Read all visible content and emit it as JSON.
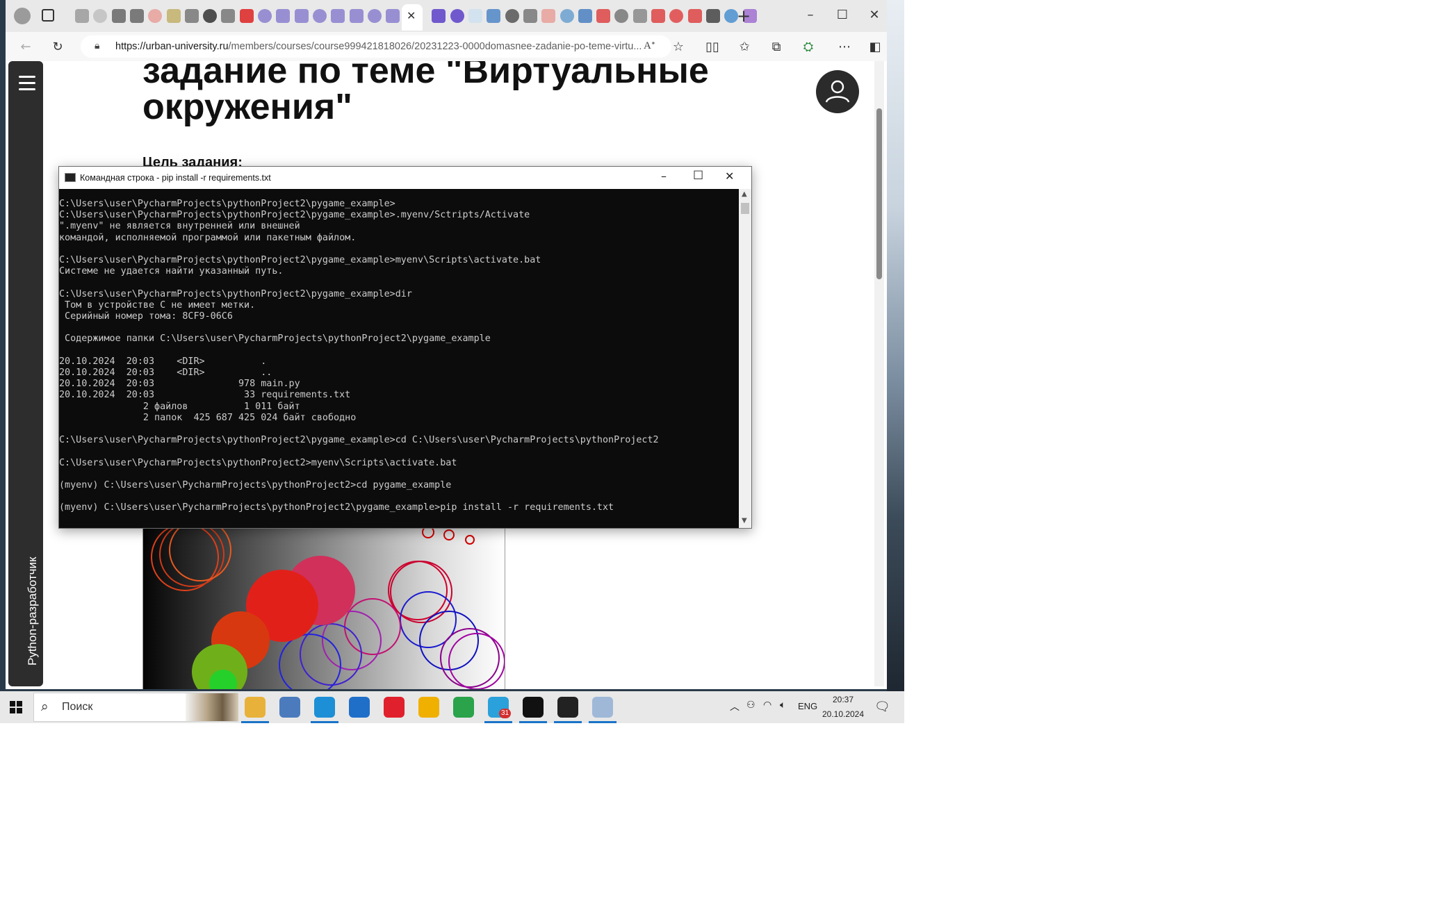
{
  "browser": {
    "url_domain": "https://urban-university.ru",
    "url_path": "/members/courses/course999421818026/20231223-0000domasnee-zadanie-po-teme-virtu...",
    "tab_colors": [
      "#9b9b9b",
      "#c0c0c0",
      "#666",
      "#666",
      "#e8a09a",
      "#c2b06a",
      "#777",
      "#333",
      "#777",
      "#d22",
      "#8a7fcf",
      "#8a7fcf",
      "#8a7fcf",
      "#8a7fcf",
      "#8a7fcf",
      "#8a7fcf",
      "#8a7fcf",
      "#8a7fcf",
      "#5a40c8",
      "#5a40c8",
      "#cfe0f0",
      "#4f86c6",
      "#555",
      "#777",
      "#e8a09a",
      "#6aa0d0",
      "#4a80c0",
      "#d44",
      "#777",
      "#888",
      "#d44",
      "#e04545",
      "#d44",
      "#444",
      "#4a8fd0",
      "#a070d0"
    ]
  },
  "page": {
    "heading": "задание по теме \"Виртуальные окружения\"",
    "goal_label": "Цель задания:",
    "course_label": "Python-разработчик"
  },
  "cmd": {
    "title": "Командная строка - pip  install -r requirements.txt",
    "lines": [
      "C:\\Users\\user\\PycharmProjects\\pythonProject2\\pygame_example>",
      "C:\\Users\\user\\PycharmProjects\\pythonProject2\\pygame_example>.myenv/Sctripts/Activate",
      "\".myenv\" не является внутренней или внешней",
      "командой, исполняемой программой или пакетным файлом.",
      "",
      "C:\\Users\\user\\PycharmProjects\\pythonProject2\\pygame_example>myenv\\Scripts\\activate.bat",
      "Системе не удается найти указанный путь.",
      "",
      "C:\\Users\\user\\PycharmProjects\\pythonProject2\\pygame_example>dir",
      " Том в устройстве C не имеет метки.",
      " Серийный номер тома: 8CF9-06C6",
      "",
      " Содержимое папки C:\\Users\\user\\PycharmProjects\\pythonProject2\\pygame_example",
      "",
      "20.10.2024  20:03    <DIR>          .",
      "20.10.2024  20:03    <DIR>          ..",
      "20.10.2024  20:03               978 main.py",
      "20.10.2024  20:03                33 requirements.txt",
      "               2 файлов          1 011 байт",
      "               2 папок  425 687 425 024 байт свободно",
      "",
      "C:\\Users\\user\\PycharmProjects\\pythonProject2\\pygame_example>cd C:\\Users\\user\\PycharmProjects\\pythonProject2",
      "",
      "C:\\Users\\user\\PycharmProjects\\pythonProject2>myenv\\Scripts\\activate.bat",
      "",
      "(myenv) C:\\Users\\user\\PycharmProjects\\pythonProject2>cd pygame_example",
      "",
      "(myenv) C:\\Users\\user\\PycharmProjects\\pythonProject2\\pygame_example>pip install -r requirements.txt"
    ]
  },
  "taskbar": {
    "search_placeholder": "Поиск",
    "lang": "ENG",
    "time": "20:37",
    "date": "20.10.2024",
    "telegram_badge": "31",
    "apps": [
      {
        "name": "explorer-icon",
        "color": "#e8b23a"
      },
      {
        "name": "python-icon",
        "color": "#4b7bbd"
      },
      {
        "name": "edge-icon",
        "color": "#1c8fd6"
      },
      {
        "name": "mail-icon",
        "color": "#1f6fc9"
      },
      {
        "name": "opera-icon",
        "color": "#e0202c"
      },
      {
        "name": "photo-app-icon",
        "color": "#f0b000"
      },
      {
        "name": "edge-green-icon",
        "color": "#2aa34a"
      },
      {
        "name": "telegram-icon",
        "color": "#2aa1da"
      },
      {
        "name": "pycharm-icon",
        "color": "#111111"
      },
      {
        "name": "terminal-icon",
        "color": "#222222"
      },
      {
        "name": "paint-icon",
        "color": "#9fb8d8"
      }
    ]
  }
}
